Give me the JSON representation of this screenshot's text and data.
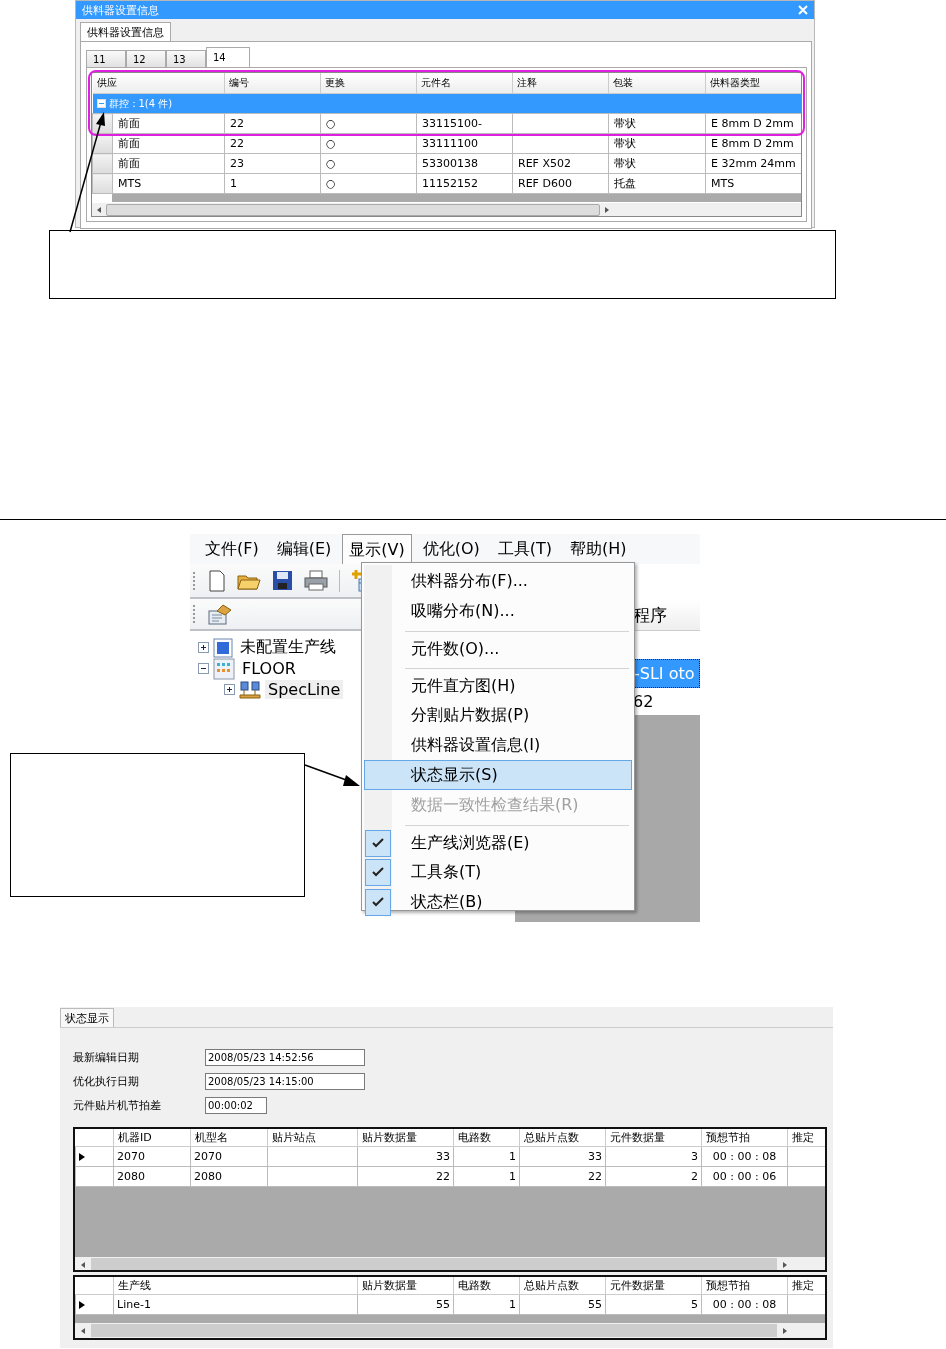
{
  "feeder_window": {
    "title": "供料器设置信息",
    "outer_tabs": [
      {
        "label": "供料器设置信息",
        "selected": true
      }
    ],
    "tabs": [
      {
        "label": "11",
        "selected": false
      },
      {
        "label": "12",
        "selected": false
      },
      {
        "label": "13",
        "selected": false
      },
      {
        "label": "14",
        "selected": true
      }
    ],
    "columns": [
      "供应",
      "编号",
      "更换",
      "元件名",
      "注释",
      "包装",
      "供料器类型"
    ],
    "group": {
      "label": "群控：1(4 件)",
      "expanded": true
    },
    "rows": [
      [
        "前面",
        "22",
        "○",
        "33115100-",
        null,
        "带状",
        "E 8mm D 2mm"
      ],
      [
        "前面",
        "22",
        "○",
        "33111100",
        null,
        "带状",
        "E 8mm D 2mm"
      ],
      [
        "前面",
        "23",
        "○",
        "53300138",
        "REF X502",
        "带状",
        "E 32mm 24mm"
      ],
      [
        "MTS",
        "1",
        "○",
        "11152152",
        "REF D600",
        "托盘",
        "MTS"
      ]
    ]
  },
  "app": {
    "menu": [
      {
        "label": "文件(F)",
        "selected": false
      },
      {
        "label": "编辑(E)",
        "selected": false
      },
      {
        "label": "显示(V)",
        "selected": true
      },
      {
        "label": "优化(O)",
        "selected": false
      },
      {
        "label": "工具(T)",
        "selected": false
      },
      {
        "label": "帮助(H)",
        "selected": false
      }
    ],
    "view_menu": [
      {
        "label": "供料器分布(F)...",
        "separator_before": false,
        "selected": false,
        "disabled": false,
        "checked": false
      },
      {
        "label": "吸嘴分布(N)...",
        "separator_before": false,
        "selected": false,
        "disabled": false,
        "checked": false
      },
      {
        "label": "元件数(O)...",
        "separator_before": true,
        "selected": false,
        "disabled": false,
        "checked": false
      },
      {
        "label": "元件直方图(H)",
        "separator_before": true,
        "selected": false,
        "disabled": false,
        "checked": false
      },
      {
        "label": "分割贴片数据(P)",
        "separator_before": false,
        "selected": false,
        "disabled": false,
        "checked": false
      },
      {
        "label": "供料器设置信息(I)",
        "separator_before": false,
        "selected": false,
        "disabled": false,
        "checked": false
      },
      {
        "label": "状态显示(S)",
        "separator_before": false,
        "selected": true,
        "disabled": false,
        "checked": false
      },
      {
        "label": "数据一致性检查结果(R)",
        "separator_before": false,
        "selected": false,
        "disabled": true,
        "checked": false
      },
      {
        "label": "生产线浏览器(E)",
        "separator_before": true,
        "selected": false,
        "disabled": false,
        "checked": true
      },
      {
        "label": "工具条(T)",
        "separator_before": false,
        "selected": false,
        "disabled": false,
        "checked": true
      },
      {
        "label": "状态栏(B)",
        "separator_before": false,
        "selected": false,
        "disabled": false,
        "checked": true
      }
    ],
    "tree": [
      {
        "label": "未配置生产线",
        "kind": "unassigned",
        "expanded": false,
        "selected": false
      },
      {
        "label": "FLOOR",
        "kind": "floor",
        "expanded": true,
        "selected": false,
        "children": [
          {
            "label": "SpecLine",
            "kind": "line",
            "expanded": false,
            "selected": true
          }
        ]
      }
    ],
    "right_pane": {
      "header": "程序",
      "rows": [
        {
          "text": "-SLI oto",
          "selected": true
        },
        {
          "text": "62",
          "selected": false
        }
      ]
    }
  },
  "status_panel": {
    "tab": {
      "label": "状态显示",
      "selected": true
    },
    "fields": [
      {
        "label": "最新编辑日期",
        "value": "2008/05/23 14:52:56"
      },
      {
        "label": "优化执行日期",
        "value": "2008/05/23 14:15:00"
      },
      {
        "label": "元件贴片机节拍差",
        "value": "00:00:02"
      }
    ],
    "machine_table": {
      "columns": [
        "机器ID",
        "机型名",
        "贴片站点",
        "贴片数据量",
        "电路数",
        "总贴片点数",
        "元件数据量",
        "预想节拍",
        "推定"
      ],
      "rows": [
        {
          "current": true,
          "cells": [
            "2070",
            "2070",
            null,
            "33",
            "1",
            "33",
            "3",
            "00 : 00 : 08",
            null
          ]
        },
        {
          "current": false,
          "cells": [
            "2080",
            "2080",
            null,
            "22",
            "1",
            "22",
            "2",
            "00 : 00 : 06",
            null
          ]
        }
      ]
    },
    "line_table": {
      "columns": [
        "生产线",
        "贴片数据量",
        "电路数",
        "总贴片点数",
        "元件数据量",
        "预想节拍",
        "推定"
      ],
      "rows": [
        {
          "current": true,
          "cells": [
            "Line-1",
            "55",
            "1",
            "55",
            "5",
            "00 : 00 : 08",
            null
          ]
        }
      ]
    }
  }
}
